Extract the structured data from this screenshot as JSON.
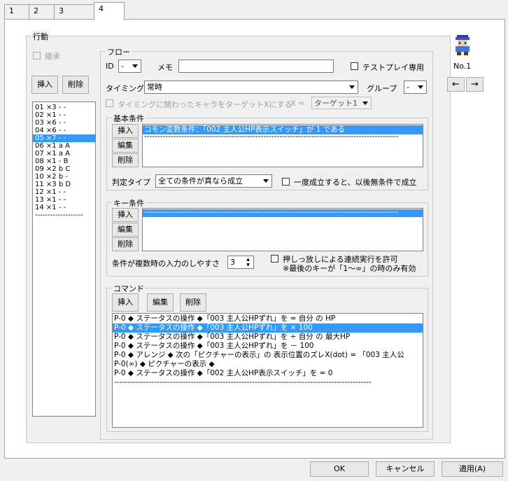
{
  "tabs": [
    "1",
    "2",
    "3",
    "4"
  ],
  "action": {
    "legend": "行動",
    "inherit_label": "継承",
    "insert_label": "挿入",
    "delete_label": "削除",
    "items": [
      "01 ×3 - -",
      "02 ×1 - -",
      "03 ×6 - -",
      "04 ×6 - -",
      "05 ×7 - -",
      "06 ×1 a A",
      "07 ×1 a A",
      "08 ×1 - B",
      "09 ×2 b C",
      "10 ×2 b -",
      "11 ×3 b D",
      "12 ×1 - -",
      "13 ×1 - -",
      "14 ×1 - -",
      "-------------------"
    ],
    "selected_index": 4
  },
  "flow": {
    "legend": "フロー",
    "id_label": "ID",
    "id_value": "-",
    "memo_label": "メモ",
    "memo_value": "",
    "test_play_label": "テストプレイ専用",
    "timing_label": "タイミング",
    "timing_value": "常時",
    "group_label": "グループ",
    "group_value": "-",
    "target_label": "タイミングに関わったキャラをターゲットXにする",
    "x_label": "X =",
    "target_value": "ターゲット1"
  },
  "basic": {
    "legend": "基本条件",
    "insert_label": "挿入",
    "edit_label": "編集",
    "delete_label": "削除",
    "items": [
      "コモン変数条件：「002 主人公HP表示スイッチ」が 1 である",
      "------------------------------------------------------------------------------------------------"
    ],
    "judge_label": "判定タイプ",
    "judge_value": "全ての条件が真なら成立",
    "once_label": "一度成立すると、以後無条件で成立"
  },
  "key": {
    "legend": "キー条件",
    "insert_label": "挿入",
    "edit_label": "編集",
    "delete_label": "削除",
    "items": [
      "------------------------------------------------------------------------------------------------"
    ],
    "ease_label": "条件が複数時の入力のしやすさ",
    "ease_value": "3",
    "hold_label": "押しっ放しによる連続実行を許可",
    "hold_note": "※最後のキーが「1～∞」の時のみ有効"
  },
  "command": {
    "legend": "コマンド",
    "insert_label": "挿入",
    "edit_label": "編集",
    "delete_label": "削除",
    "items": [
      "P-0 ◆ ステータスの操作 ◆「003 主人公HPずれ」を = 自分 の HP",
      "P-0 ◆ ステータスの操作 ◆「003 主人公HPずれ」を × 100",
      "P-0 ◆ ステータスの操作 ◆「003 主人公HPずれ」を ÷ 自分 の 最大HP",
      "P-0 ◆ ステータスの操作 ◆「003 主人公HPずれ」を － 100",
      "P-0 ◆ アレンジ ◆ 次の「ピクチャーの表示」の 表示位置のズレX(dot) = 「003 主人公",
      "P-0(∞) ◆ ピクチャーの表示 ◆",
      "P-0 ◆ ステータスの操作 ◆「002 主人公HP表示スイッチ」を = 0",
      "-------------------------------------------------------------------------------------------------"
    ],
    "selected_index": 1
  },
  "character": {
    "label": "No.1"
  },
  "nav": {
    "prev": "←",
    "next": "→"
  },
  "footer": {
    "ok": "OK",
    "cancel": "キャンセル",
    "apply": "適用(A)"
  },
  "colors": {
    "selection": "#3399ff",
    "panel": "#ffffff",
    "window": "#f0f0f0"
  }
}
